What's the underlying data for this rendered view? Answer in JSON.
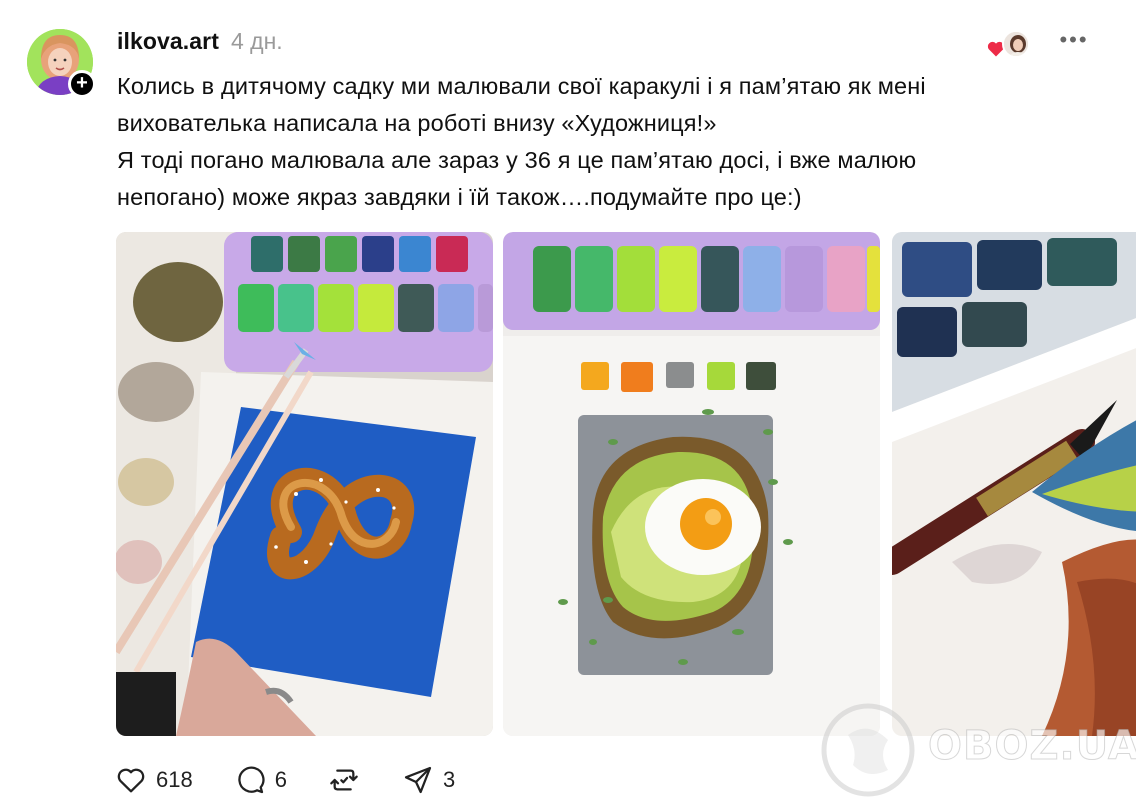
{
  "post": {
    "username": "ilkova.art",
    "time": "4 дн.",
    "follow_symbol": "+",
    "more_symbol": "•••",
    "text_lines": [
      "Колись в дитячому садку ми малювали свої каракулі і я пам’ятаю як мені",
      "вихователька написала на роботі внизу «Художниця!»",
      "Я тоді погано малювала але зараз у 36 я це пам’ятаю досі, і вже малюю",
      "непогано) може якраз завдяки і їй також….подумайте про це:)"
    ]
  },
  "actions": {
    "likes": "618",
    "comments": "6",
    "shares": "3"
  },
  "icons": {
    "like": "heart-icon",
    "comment": "comment-bubble-icon",
    "repost": "repost-icon",
    "share": "send-icon",
    "liked_by": "red-heart-icon"
  },
  "colors": {
    "like_heart": "#ed2b47",
    "text": "#101010",
    "muted": "#9a9a9a"
  },
  "watermark": {
    "text": "OBOZ.UA"
  }
}
